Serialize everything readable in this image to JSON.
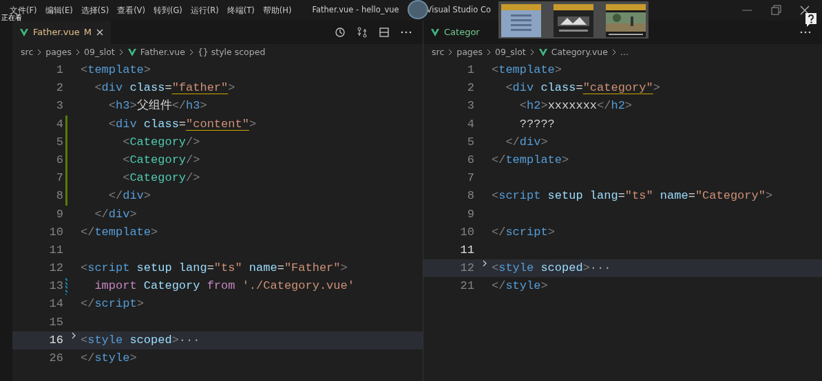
{
  "title_bar": {
    "menu": [
      "文件(F)",
      "编辑(E)",
      "选择(S)",
      "查看(V)",
      "转到(G)",
      "运行(R)",
      "终端(T)",
      "帮助(H)"
    ],
    "overlay_label": "正在看",
    "title": "Father.vue - hello_vue",
    "title_tail": "Visual Studio Co"
  },
  "editors": [
    {
      "tab": {
        "label": "Father.vue",
        "badge": "M",
        "selected": true
      },
      "breadcrumbs": [
        "src",
        "pages",
        "09_slot",
        "Father.vue",
        "{} style scoped"
      ],
      "lines": [
        {
          "number": "1",
          "tokens": [
            {
              "text": "<",
              "kind": "punct"
            },
            {
              "text": "template",
              "kind": "tag"
            },
            {
              "text": ">",
              "kind": "punct"
            }
          ]
        },
        {
          "number": "2",
          "tokens": [
            {
              "text": "  <",
              "kind": "punct"
            },
            {
              "text": "div",
              "kind": "tag"
            },
            {
              "text": " class",
              "kind": "attr"
            },
            {
              "text": "=",
              "kind": "plain"
            },
            {
              "text": "\"father\"",
              "kind": "string",
              "underlined": true
            },
            {
              "text": ">",
              "kind": "punct"
            }
          ]
        },
        {
          "number": "3",
          "tokens": [
            {
              "text": "    <",
              "kind": "punct"
            },
            {
              "text": "h3",
              "kind": "tag"
            },
            {
              "text": ">",
              "kind": "punct"
            },
            {
              "text": "父组件",
              "kind": "plain"
            },
            {
              "text": "</",
              "kind": "punct"
            },
            {
              "text": "h3",
              "kind": "tag"
            },
            {
              "text": ">",
              "kind": "punct"
            }
          ]
        },
        {
          "number": "4",
          "added": true,
          "tokens": [
            {
              "text": "    <",
              "kind": "punct"
            },
            {
              "text": "div",
              "kind": "tag"
            },
            {
              "text": " class",
              "kind": "attr"
            },
            {
              "text": "=",
              "kind": "plain"
            },
            {
              "text": "\"content\"",
              "kind": "string",
              "underlined": true
            },
            {
              "text": ">",
              "kind": "punct"
            }
          ]
        },
        {
          "number": "5",
          "added": true,
          "tokens": [
            {
              "text": "      <",
              "kind": "punct"
            },
            {
              "text": "Category",
              "kind": "component"
            },
            {
              "text": "/>",
              "kind": "punct"
            }
          ]
        },
        {
          "number": "6",
          "added": true,
          "tokens": [
            {
              "text": "      <",
              "kind": "punct"
            },
            {
              "text": "Category",
              "kind": "component"
            },
            {
              "text": "/>",
              "kind": "punct"
            }
          ]
        },
        {
          "number": "7",
          "added": true,
          "tokens": [
            {
              "text": "      <",
              "kind": "punct"
            },
            {
              "text": "Category",
              "kind": "component"
            },
            {
              "text": "/>",
              "kind": "punct"
            }
          ]
        },
        {
          "number": "8",
          "added": true,
          "tokens": [
            {
              "text": "    </",
              "kind": "punct"
            },
            {
              "text": "div",
              "kind": "tag"
            },
            {
              "text": ">",
              "kind": "punct"
            }
          ]
        },
        {
          "number": "9",
          "tokens": [
            {
              "text": "  </",
              "kind": "punct"
            },
            {
              "text": "div",
              "kind": "tag"
            },
            {
              "text": ">",
              "kind": "punct"
            }
          ]
        },
        {
          "number": "10",
          "tokens": [
            {
              "text": "</",
              "kind": "punct"
            },
            {
              "text": "template",
              "kind": "tag"
            },
            {
              "text": ">",
              "kind": "punct"
            }
          ]
        },
        {
          "number": "11"
        },
        {
          "number": "12",
          "tokens": [
            {
              "text": "<",
              "kind": "punct"
            },
            {
              "text": "script",
              "kind": "tag"
            },
            {
              "text": " setup lang",
              "kind": "attr"
            },
            {
              "text": "=",
              "kind": "plain"
            },
            {
              "text": "\"ts\"",
              "kind": "string"
            },
            {
              "text": " name",
              "kind": "attr"
            },
            {
              "text": "=",
              "kind": "plain"
            },
            {
              "text": "\"Father\"",
              "kind": "string"
            },
            {
              "text": ">",
              "kind": "punct"
            }
          ]
        },
        {
          "number": "13",
          "modified": true,
          "tokens": [
            {
              "text": "  import",
              "kind": "keyword"
            },
            {
              "text": " Category ",
              "kind": "attr"
            },
            {
              "text": "from",
              "kind": "keyword"
            },
            {
              "text": " './Category.vue'",
              "kind": "string"
            }
          ]
        },
        {
          "number": "14",
          "tokens": [
            {
              "text": "</",
              "kind": "punct"
            },
            {
              "text": "script",
              "kind": "tag"
            },
            {
              "text": ">",
              "kind": "punct"
            }
          ]
        },
        {
          "number": "15"
        },
        {
          "number": "16",
          "current": true,
          "folded": true,
          "tokens": [
            {
              "text": "<",
              "kind": "punct"
            },
            {
              "text": "style",
              "kind": "tag"
            },
            {
              "text": " scoped",
              "kind": "attr"
            },
            {
              "text": ">",
              "kind": "punct"
            },
            {
              "text": "···",
              "kind": "fold"
            }
          ]
        },
        {
          "number": "26",
          "tokens": [
            {
              "text": "</",
              "kind": "punct"
            },
            {
              "text": "style",
              "kind": "tag"
            },
            {
              "text": ">",
              "kind": "punct"
            }
          ]
        }
      ]
    },
    {
      "tab": {
        "label": "Categor",
        "selected": false
      },
      "breadcrumbs": [
        "src",
        "pages",
        "09_slot",
        "Category.vue",
        "..."
      ],
      "lines": [
        {
          "number": "1",
          "tokens": [
            {
              "text": "<",
              "kind": "punct"
            },
            {
              "text": "template",
              "kind": "tag"
            },
            {
              "text": ">",
              "kind": "punct"
            }
          ]
        },
        {
          "number": "2",
          "tokens": [
            {
              "text": "  <",
              "kind": "punct"
            },
            {
              "text": "div",
              "kind": "tag"
            },
            {
              "text": " class",
              "kind": "attr"
            },
            {
              "text": "=",
              "kind": "plain"
            },
            {
              "text": "\"category\"",
              "kind": "string",
              "underlined": true
            },
            {
              "text": ">",
              "kind": "punct"
            }
          ]
        },
        {
          "number": "3",
          "tokens": [
            {
              "text": "    <",
              "kind": "punct"
            },
            {
              "text": "h2",
              "kind": "tag"
            },
            {
              "text": ">",
              "kind": "punct"
            },
            {
              "text": "xxxxxxx",
              "kind": "plain"
            },
            {
              "text": "</",
              "kind": "punct"
            },
            {
              "text": "h2",
              "kind": "tag"
            },
            {
              "text": ">",
              "kind": "punct"
            }
          ]
        },
        {
          "number": "4",
          "tokens": [
            {
              "text": "    ?????",
              "kind": "plain"
            }
          ]
        },
        {
          "number": "5",
          "tokens": [
            {
              "text": "  </",
              "kind": "punct"
            },
            {
              "text": "div",
              "kind": "tag"
            },
            {
              "text": ">",
              "kind": "punct"
            }
          ]
        },
        {
          "number": "6",
          "tokens": [
            {
              "text": "</",
              "kind": "punct"
            },
            {
              "text": "template",
              "kind": "tag"
            },
            {
              "text": ">",
              "kind": "punct"
            }
          ]
        },
        {
          "number": "7"
        },
        {
          "number": "8",
          "tokens": [
            {
              "text": "<",
              "kind": "punct"
            },
            {
              "text": "script",
              "kind": "tag"
            },
            {
              "text": " setup lang",
              "kind": "attr"
            },
            {
              "text": "=",
              "kind": "plain"
            },
            {
              "text": "\"ts\"",
              "kind": "string"
            },
            {
              "text": " name",
              "kind": "attr"
            },
            {
              "text": "=",
              "kind": "plain"
            },
            {
              "text": "\"Category\"",
              "kind": "string"
            },
            {
              "text": ">",
              "kind": "punct"
            }
          ]
        },
        {
          "number": "9"
        },
        {
          "number": "10",
          "tokens": [
            {
              "text": "</",
              "kind": "punct"
            },
            {
              "text": "script",
              "kind": "tag"
            },
            {
              "text": ">",
              "kind": "punct"
            }
          ]
        },
        {
          "number": "11",
          "current": true
        },
        {
          "number": "12",
          "folded": true,
          "highlighted": true,
          "tokens": [
            {
              "text": "<",
              "kind": "punct"
            },
            {
              "text": "style",
              "kind": "tag"
            },
            {
              "text": " scoped",
              "kind": "attr"
            },
            {
              "text": ">",
              "kind": "punct"
            },
            {
              "text": "···",
              "kind": "fold"
            }
          ]
        },
        {
          "number": "21",
          "tokens": [
            {
              "text": "</",
              "kind": "punct"
            },
            {
              "text": "style",
              "kind": "tag"
            },
            {
              "text": ">",
              "kind": "punct"
            }
          ]
        }
      ]
    }
  ]
}
